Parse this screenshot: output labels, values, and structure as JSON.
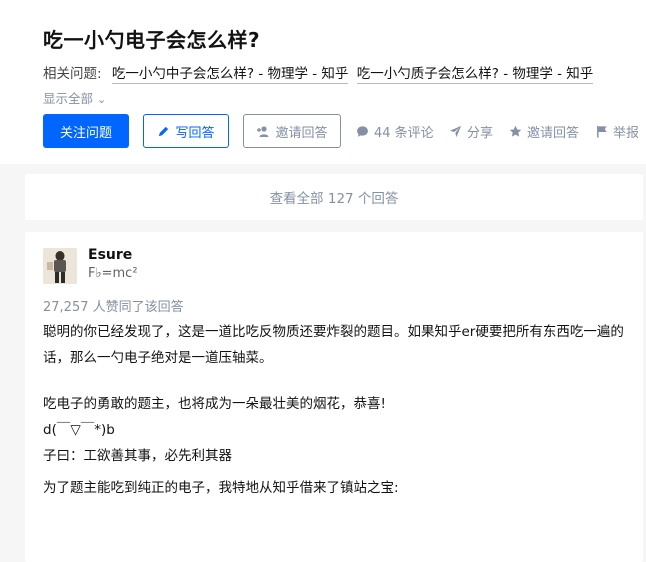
{
  "question": {
    "title": "吃一小勺电子会怎么样?",
    "related_label": "相关问题:",
    "related": [
      "吃一小勺中子会怎么样? - 物理学 - 知乎",
      "吃一小勺质子会怎么样? - 物理学 - 知乎"
    ],
    "show_all": "显示全部"
  },
  "actions": {
    "follow": "关注问题",
    "write": "写回答",
    "invite": "邀请回答",
    "comments": "44 条评论",
    "share": "分享",
    "invite2": "邀请回答",
    "report": "举报"
  },
  "view_all": "查看全部 127 个回答",
  "answer": {
    "author_name": "Esure",
    "author_bio": "F♭=mc²",
    "voters": "27,257 人赞同了该回答",
    "paragraphs": [
      "聪明的你已经发现了，这是一道比吃反物质还要炸裂的题目。如果知乎er硬要把所有东西吃一遍的话，那么一勺电子绝对是一道压轴菜。",
      "",
      "吃电子的勇敢的题主，也将成为一朵最壮美的烟花，恭喜!",
      "d(￣▽￣*)b",
      "子曰：工欲善其事，必先利其器",
      "为了题主能吃到纯正的电子，我特地从知乎借来了镇站之宝:"
    ]
  },
  "colors": {
    "brand": "#0066ff",
    "muted": "#8590a6"
  }
}
